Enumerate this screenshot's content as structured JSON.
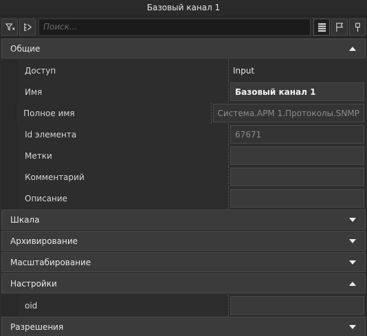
{
  "window": {
    "title": "Базовый канал 1"
  },
  "toolbar": {
    "search_placeholder": "Поиск..."
  },
  "sections": {
    "general": {
      "label": "Общие",
      "expanded": true,
      "rows": {
        "access": {
          "name": "Доступ",
          "value": "Input"
        },
        "name": {
          "name": "Имя",
          "value": "Базовый канал 1"
        },
        "full_name": {
          "name": "Полное имя",
          "value": "Система.APM 1.Протоколы.SNMP"
        },
        "element_id": {
          "name": "Id элемента",
          "value": "67671"
        },
        "tags": {
          "name": "Метки",
          "value": ""
        },
        "comment": {
          "name": "Комментарий",
          "value": ""
        },
        "description": {
          "name": "Описание",
          "value": ""
        }
      }
    },
    "scale": {
      "label": "Шкала",
      "expanded": false
    },
    "archiving": {
      "label": "Архивирование",
      "expanded": false
    },
    "scaling": {
      "label": "Масштабирование",
      "expanded": false
    },
    "settings": {
      "label": "Настройки",
      "expanded": true,
      "rows": {
        "oid": {
          "name": "oid",
          "value": ""
        }
      }
    },
    "permissions": {
      "label": "Разрешения",
      "expanded": false
    }
  },
  "icons": {
    "filter": "filter-icon",
    "collapse": "collapse-tree-icon",
    "list": "list-view-icon",
    "flag": "flag-icon",
    "pin": "pin-icon",
    "expanded": "chevron-up-icon",
    "collapsed": "chevron-down-icon"
  }
}
